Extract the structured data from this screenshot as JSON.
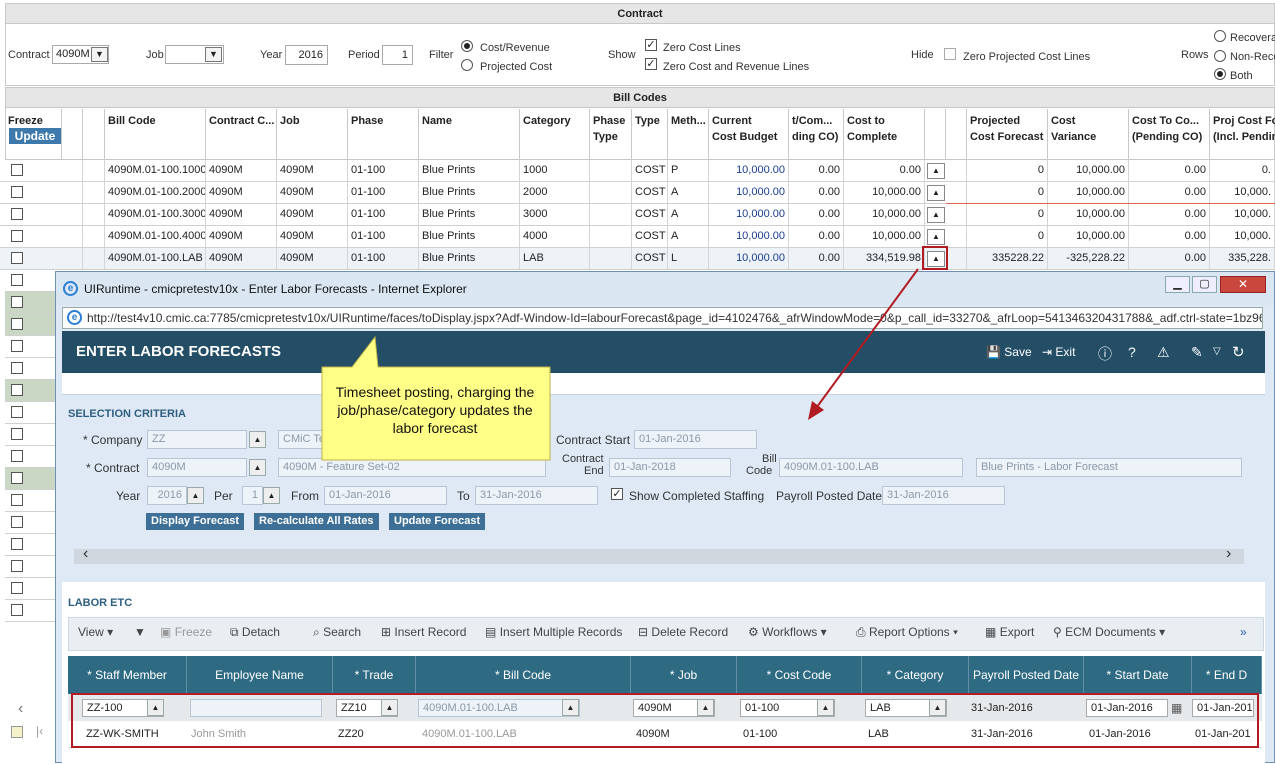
{
  "contract_section": {
    "title": "Contract",
    "contract_label": "Contract",
    "contract_value": "4090M",
    "job_label": "Job",
    "job_value": "",
    "year_label": "Year",
    "year_value": "2016",
    "period_label": "Period",
    "period_value": "1",
    "filter_label": "Filter",
    "filter_options": [
      "Cost/Revenue",
      "Projected Cost"
    ],
    "show_label": "Show",
    "show_options": [
      "Zero Cost Lines",
      "Zero Cost and Revenue Lines"
    ],
    "hide_label": "Hide",
    "hide_option": "Zero Projected Cost Lines",
    "rows_label": "Rows",
    "rows_options": [
      "Recoveral",
      "Non-Reco",
      "Both"
    ]
  },
  "billcodes": {
    "title": "Bill Codes",
    "freeze_label": "Freeze",
    "update_label": "Update",
    "headers": {
      "bill_code": "Bill Code",
      "contract": "Contract C...",
      "job": "Job",
      "phase": "Phase",
      "name": "Name",
      "category": "Category",
      "phase_type1": "Phase",
      "phase_type2": "Type",
      "type": "Type",
      "method": "Meth...",
      "ccb1": "Current",
      "ccb2": "Cost Budget",
      "com1": "t/Com...",
      "com2": "ding CO)",
      "ctc1": "Cost to",
      "ctc2": "Complete",
      "pcf1": "Projected",
      "pcf2": "Cost Forecast",
      "cv1": "Cost",
      "cv2": "Variance",
      "ctco1": "Cost To Co...",
      "ctco2": "(Pending CO)",
      "pjc1": "Proj Cost Fo",
      "pjc2": "(Incl. Pendin"
    },
    "rows": [
      {
        "bill_code": "4090M.01-100.1000",
        "contract": "4090M",
        "job": "4090M",
        "phase": "01-100",
        "name": "Blue Prints",
        "category": "1000",
        "type": "COST",
        "method": "P",
        "budget": "10,000.00",
        "committed": "0.00",
        "ctc": "0.00",
        "pcf": "0",
        "variance": "10,000.00",
        "ctco": "0.00",
        "proj": "0."
      },
      {
        "bill_code": "4090M.01-100.2000",
        "contract": "4090M",
        "job": "4090M",
        "phase": "01-100",
        "name": "Blue Prints",
        "category": "2000",
        "type": "COST",
        "method": "A",
        "budget": "10,000.00",
        "committed": "0.00",
        "ctc": "10,000.00",
        "pcf": "0",
        "variance": "10,000.00",
        "ctco": "0.00",
        "proj": "10,000."
      },
      {
        "bill_code": "4090M.01-100.3000",
        "contract": "4090M",
        "job": "4090M",
        "phase": "01-100",
        "name": "Blue Prints",
        "category": "3000",
        "type": "COST",
        "method": "A",
        "budget": "10,000.00",
        "committed": "0.00",
        "ctc": "10,000.00",
        "pcf": "0",
        "variance": "10,000.00",
        "ctco": "0.00",
        "proj": "10,000."
      },
      {
        "bill_code": "4090M.01-100.4000",
        "contract": "4090M",
        "job": "4090M",
        "phase": "01-100",
        "name": "Blue Prints",
        "category": "4000",
        "type": "COST",
        "method": "A",
        "budget": "10,000.00",
        "committed": "0.00",
        "ctc": "10,000.00",
        "pcf": "0",
        "variance": "10,000.00",
        "ctco": "0.00",
        "proj": "10,000."
      },
      {
        "bill_code": "4090M.01-100.LAB",
        "contract": "4090M",
        "job": "4090M",
        "phase": "01-100",
        "name": "Blue Prints",
        "category": "LAB",
        "type": "COST",
        "method": "L",
        "budget": "10,000.00",
        "committed": "0.00",
        "ctc": "334,519.98",
        "pcf": "335228.22",
        "variance": "-325,228.22",
        "ctco": "0.00",
        "proj": "335,228."
      }
    ]
  },
  "ie_window": {
    "title": "UIRuntime - cmicpretestv10x - Enter Labor Forecasts - Internet Explorer",
    "url": "http://test4v10.cmic.ca:7785/cmicpretestv10x/UIRuntime/faces/toDisplay.jspx?Adf-Window-Id=labourForecast&page_id=4102476&_afrWindowMode=0&p_call_id=33270&_afrLoop=541346320431788&_adf.ctrl-state=1bz96ec"
  },
  "app": {
    "title": "ENTER LABOR FORECASTS",
    "save": "Save",
    "exit": "Exit"
  },
  "callout": "Timesheet posting, charging the job/phase/category updates the labor forecast",
  "selection": {
    "title": "SELECTION CRITERIA",
    "company_label": "* Company",
    "company_value": "ZZ",
    "company_desc": "CMiC Te",
    "contract_label": "* Contract",
    "contract_value": "4090M",
    "contract_desc": "4090M - Feature Set-02",
    "contract_start_label": "Contract Start",
    "contract_start": "01-Jan-2016",
    "contract_end_label1": "Contract",
    "contract_end_label2": "End",
    "contract_end": "01-Jan-2018",
    "bill_code_label1": "Bill",
    "bill_code_label2": "Code",
    "bill_code": "4090M.01-100.LAB",
    "bill_desc": "Blue Prints - Labor Forecast",
    "year_label": "Year",
    "year_value": "2016",
    "per_label": "Per",
    "per_value": "1",
    "from_label": "From",
    "from_value": "01-Jan-2016",
    "to_label": "To",
    "to_value": "31-Jan-2016",
    "show_completed": "Show Completed Staffing",
    "payroll_label": "Payroll Posted Date",
    "payroll_value": "31-Jan-2016",
    "btn_display": "Display Forecast",
    "btn_recalc": "Re-calculate All Rates",
    "btn_update": "Update Forecast"
  },
  "labor": {
    "title": "LABOR ETC",
    "toolbar": [
      "View",
      "Freeze",
      "Detach",
      "Search",
      "Insert Record",
      "Insert Multiple Records",
      "Delete Record",
      "Workflows",
      "Report Options",
      "Export",
      "ECM Documents"
    ],
    "headers": [
      "* Staff Member",
      "Employee Name",
      "* Trade",
      "* Bill Code",
      "* Job",
      "* Cost Code",
      "* Category",
      "Payroll Posted Date",
      "* Start Date",
      "* End D"
    ],
    "rows": [
      {
        "staff": "ZZ-100",
        "name": "",
        "trade": "ZZ10",
        "bill": "4090M.01-100.LAB",
        "job": "4090M",
        "cost": "01-100",
        "cat": "LAB",
        "payroll": "31-Jan-2016",
        "start": "01-Jan-2016",
        "end": "01-Jan-201"
      },
      {
        "staff": "ZZ-WK-SMITH",
        "name": "John Smith",
        "trade": "ZZ20",
        "bill": "4090M.01-100.LAB",
        "job": "4090M",
        "cost": "01-100",
        "cat": "LAB",
        "payroll": "31-Jan-2016",
        "start": "01-Jan-2016",
        "end": "01-Jan-201"
      }
    ]
  }
}
